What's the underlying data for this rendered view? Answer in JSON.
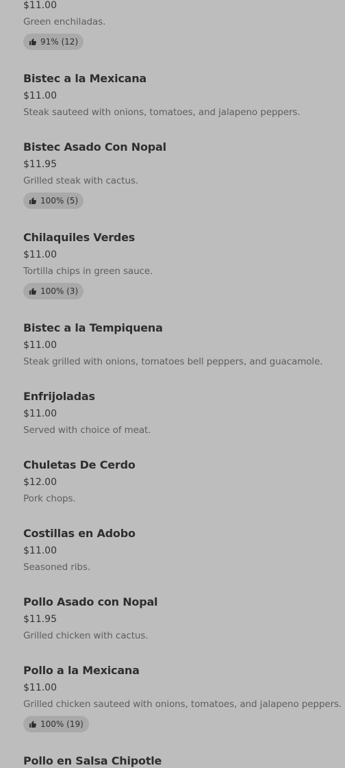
{
  "menu": {
    "items": [
      {
        "name": "",
        "price": "$11.00",
        "description": "Green enchiladas.",
        "rating": "91% (12)"
      },
      {
        "name": "Bistec a la Mexicana",
        "price": "$11.00",
        "description": "Steak sauteed with onions, tomatoes, and jalapeno peppers.",
        "rating": null
      },
      {
        "name": "Bistec Asado Con Nopal",
        "price": "$11.95",
        "description": "Grilled steak with cactus.",
        "rating": "100% (5)"
      },
      {
        "name": "Chilaquiles Verdes",
        "price": "$11.00",
        "description": "Tortilla chips in green sauce.",
        "rating": "100% (3)"
      },
      {
        "name": "Bistec a la Tempiquena",
        "price": "$11.00",
        "description": "Steak grilled with onions, tomatoes bell peppers, and guacamole.",
        "rating": null
      },
      {
        "name": "Enfrijoladas",
        "price": "$11.00",
        "description": "Served with choice of meat.",
        "rating": null
      },
      {
        "name": "Chuletas De Cerdo",
        "price": "$12.00",
        "description": "Pork chops.",
        "rating": null
      },
      {
        "name": "Costillas en Adobo",
        "price": "$11.00",
        "description": "Seasoned ribs.",
        "rating": null
      },
      {
        "name": "Pollo Asado con Nopal",
        "price": "$11.95",
        "description": "Grilled chicken with cactus.",
        "rating": null
      },
      {
        "name": "Pollo a la Mexicana",
        "price": "$11.00",
        "description": "Grilled chicken sauteed with onions, tomatoes, and jalapeno peppers.",
        "rating": "100% (19)"
      },
      {
        "name": "Pollo en Salsa Chipotle",
        "price": "",
        "description": "",
        "rating": null
      }
    ]
  },
  "icons": {
    "rating": "thumbs-up-icon"
  },
  "colors": {
    "background": "#bdbdbd",
    "badge_background": "#a9a9a9",
    "title_text": "#2e2e2e",
    "description_text": "#5e5e5e"
  }
}
